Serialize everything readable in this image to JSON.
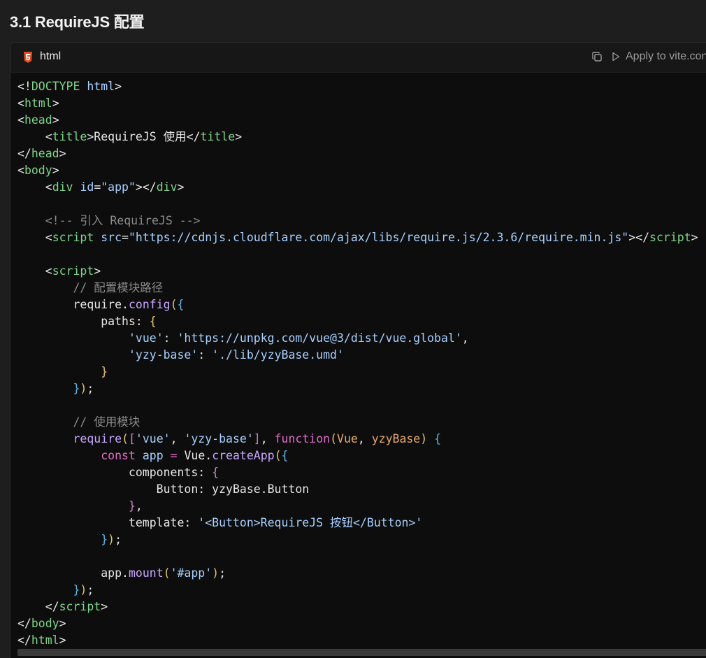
{
  "section": {
    "title": "3.1 RequireJS 配置"
  },
  "code_block": {
    "language": "html",
    "language_icon": "html5-icon",
    "copy_icon": "copy-icon",
    "apply_label": "Apply to vite.con",
    "colors": {
      "tag": "#7fd48a",
      "attr": "#a8d0ff",
      "string": "#a8d0ff",
      "comment": "#8b8b8b",
      "keyword": "#e06cc7",
      "function": "#c7a6ff",
      "param": "#e8a86c",
      "html5_icon": "#e44d26"
    },
    "lines": [
      [
        [
          "b",
          "<!"
        ],
        [
          "t",
          "DOCTYPE"
        ],
        [
          "p",
          " "
        ],
        [
          "a",
          "html"
        ],
        [
          "b",
          ">"
        ]
      ],
      [
        [
          "b",
          "<"
        ],
        [
          "t",
          "html"
        ],
        [
          "b",
          ">"
        ]
      ],
      [
        [
          "b",
          "<"
        ],
        [
          "t",
          "head"
        ],
        [
          "b",
          ">"
        ]
      ],
      [
        [
          "p",
          "    "
        ],
        [
          "b",
          "<"
        ],
        [
          "t",
          "title"
        ],
        [
          "b",
          ">"
        ],
        [
          "p",
          "RequireJS 使用"
        ],
        [
          "b",
          "</"
        ],
        [
          "t",
          "title"
        ],
        [
          "b",
          ">"
        ]
      ],
      [
        [
          "b",
          "</"
        ],
        [
          "t",
          "head"
        ],
        [
          "b",
          ">"
        ]
      ],
      [
        [
          "b",
          "<"
        ],
        [
          "t",
          "body"
        ],
        [
          "b",
          ">"
        ]
      ],
      [
        [
          "p",
          "    "
        ],
        [
          "b",
          "<"
        ],
        [
          "t",
          "div"
        ],
        [
          "p",
          " "
        ],
        [
          "a",
          "id"
        ],
        [
          "p",
          "="
        ],
        [
          "s",
          "\"app\""
        ],
        [
          "b",
          "></"
        ],
        [
          "t",
          "div"
        ],
        [
          "b",
          ">"
        ]
      ],
      [
        [
          "p",
          ""
        ]
      ],
      [
        [
          "p",
          "    "
        ],
        [
          "c",
          "<!-- 引入 RequireJS -->"
        ]
      ],
      [
        [
          "p",
          "    "
        ],
        [
          "b",
          "<"
        ],
        [
          "t",
          "script"
        ],
        [
          "p",
          " "
        ],
        [
          "a",
          "src"
        ],
        [
          "p",
          "="
        ],
        [
          "s",
          "\"https://cdnjs.cloudflare.com/ajax/libs/require.js/2.3.6/require.min.js\""
        ],
        [
          "b",
          "></"
        ],
        [
          "t",
          "script"
        ],
        [
          "b",
          ">"
        ]
      ],
      [
        [
          "p",
          ""
        ]
      ],
      [
        [
          "p",
          "    "
        ],
        [
          "b",
          "<"
        ],
        [
          "t",
          "script"
        ],
        [
          "b",
          ">"
        ]
      ],
      [
        [
          "p",
          "        "
        ],
        [
          "c",
          "// 配置模块路径"
        ]
      ],
      [
        [
          "p",
          "        require."
        ],
        [
          "f",
          "config"
        ],
        [
          "y",
          "("
        ],
        [
          "g",
          "{"
        ]
      ],
      [
        [
          "p",
          "            paths: "
        ],
        [
          "y",
          "{"
        ]
      ],
      [
        [
          "p",
          "                "
        ],
        [
          "s",
          "'vue'"
        ],
        [
          "p",
          ": "
        ],
        [
          "s",
          "'https://unpkg.com/vue@3/dist/vue.global'"
        ],
        [
          "p",
          ","
        ]
      ],
      [
        [
          "p",
          "                "
        ],
        [
          "s",
          "'yzy-base'"
        ],
        [
          "p",
          ": "
        ],
        [
          "s",
          "'./lib/yzyBase.umd'"
        ]
      ],
      [
        [
          "p",
          "            "
        ],
        [
          "y",
          "}"
        ]
      ],
      [
        [
          "p",
          "        "
        ],
        [
          "g",
          "}"
        ],
        [
          "y",
          ")"
        ],
        [
          "p",
          ";"
        ]
      ],
      [
        [
          "p",
          ""
        ]
      ],
      [
        [
          "p",
          "        "
        ],
        [
          "c",
          "// 使用模块"
        ]
      ],
      [
        [
          "f",
          "        require"
        ],
        [
          "y",
          "("
        ],
        [
          "m",
          "["
        ],
        [
          "s",
          "'vue'"
        ],
        [
          "p",
          ", "
        ],
        [
          "s",
          "'yzy-base'"
        ],
        [
          "m",
          "]"
        ],
        [
          "p",
          ", "
        ],
        [
          "k",
          "function"
        ],
        [
          "y",
          "("
        ],
        [
          "r",
          "Vue"
        ],
        [
          "p",
          ", "
        ],
        [
          "r",
          "yzyBase"
        ],
        [
          "y",
          ")"
        ],
        [
          "p",
          " "
        ],
        [
          "g",
          "{"
        ]
      ],
      [
        [
          "p",
          "            "
        ],
        [
          "k",
          "const"
        ],
        [
          "p",
          " "
        ],
        [
          "a",
          "app"
        ],
        [
          "p",
          " "
        ],
        [
          "k",
          "="
        ],
        [
          "p",
          " Vue."
        ],
        [
          "f",
          "createApp"
        ],
        [
          "y",
          "("
        ],
        [
          "g",
          "{"
        ]
      ],
      [
        [
          "p",
          "                components: "
        ],
        [
          "m",
          "{"
        ]
      ],
      [
        [
          "p",
          "                    Button: yzyBase.Button"
        ]
      ],
      [
        [
          "p",
          "                "
        ],
        [
          "m",
          "}"
        ],
        [
          "p",
          ","
        ]
      ],
      [
        [
          "p",
          "                template: "
        ],
        [
          "s",
          "'<Button>RequireJS 按钮</Button>'"
        ]
      ],
      [
        [
          "p",
          "            "
        ],
        [
          "g",
          "}"
        ],
        [
          "y",
          ")"
        ],
        [
          "p",
          ";"
        ]
      ],
      [
        [
          "p",
          ""
        ]
      ],
      [
        [
          "p",
          "            app."
        ],
        [
          "f",
          "mount"
        ],
        [
          "y",
          "("
        ],
        [
          "s",
          "'#app'"
        ],
        [
          "y",
          ")"
        ],
        [
          "p",
          ";"
        ]
      ],
      [
        [
          "p",
          "        "
        ],
        [
          "g",
          "}"
        ],
        [
          "y",
          ")"
        ],
        [
          "p",
          ";"
        ]
      ],
      [
        [
          "p",
          "    "
        ],
        [
          "b",
          "</"
        ],
        [
          "t",
          "script"
        ],
        [
          "b",
          ">"
        ]
      ],
      [
        [
          "b",
          "</"
        ],
        [
          "t",
          "body"
        ],
        [
          "b",
          ">"
        ]
      ],
      [
        [
          "b",
          "</"
        ],
        [
          "t",
          "html"
        ],
        [
          "b",
          ">"
        ]
      ]
    ]
  }
}
